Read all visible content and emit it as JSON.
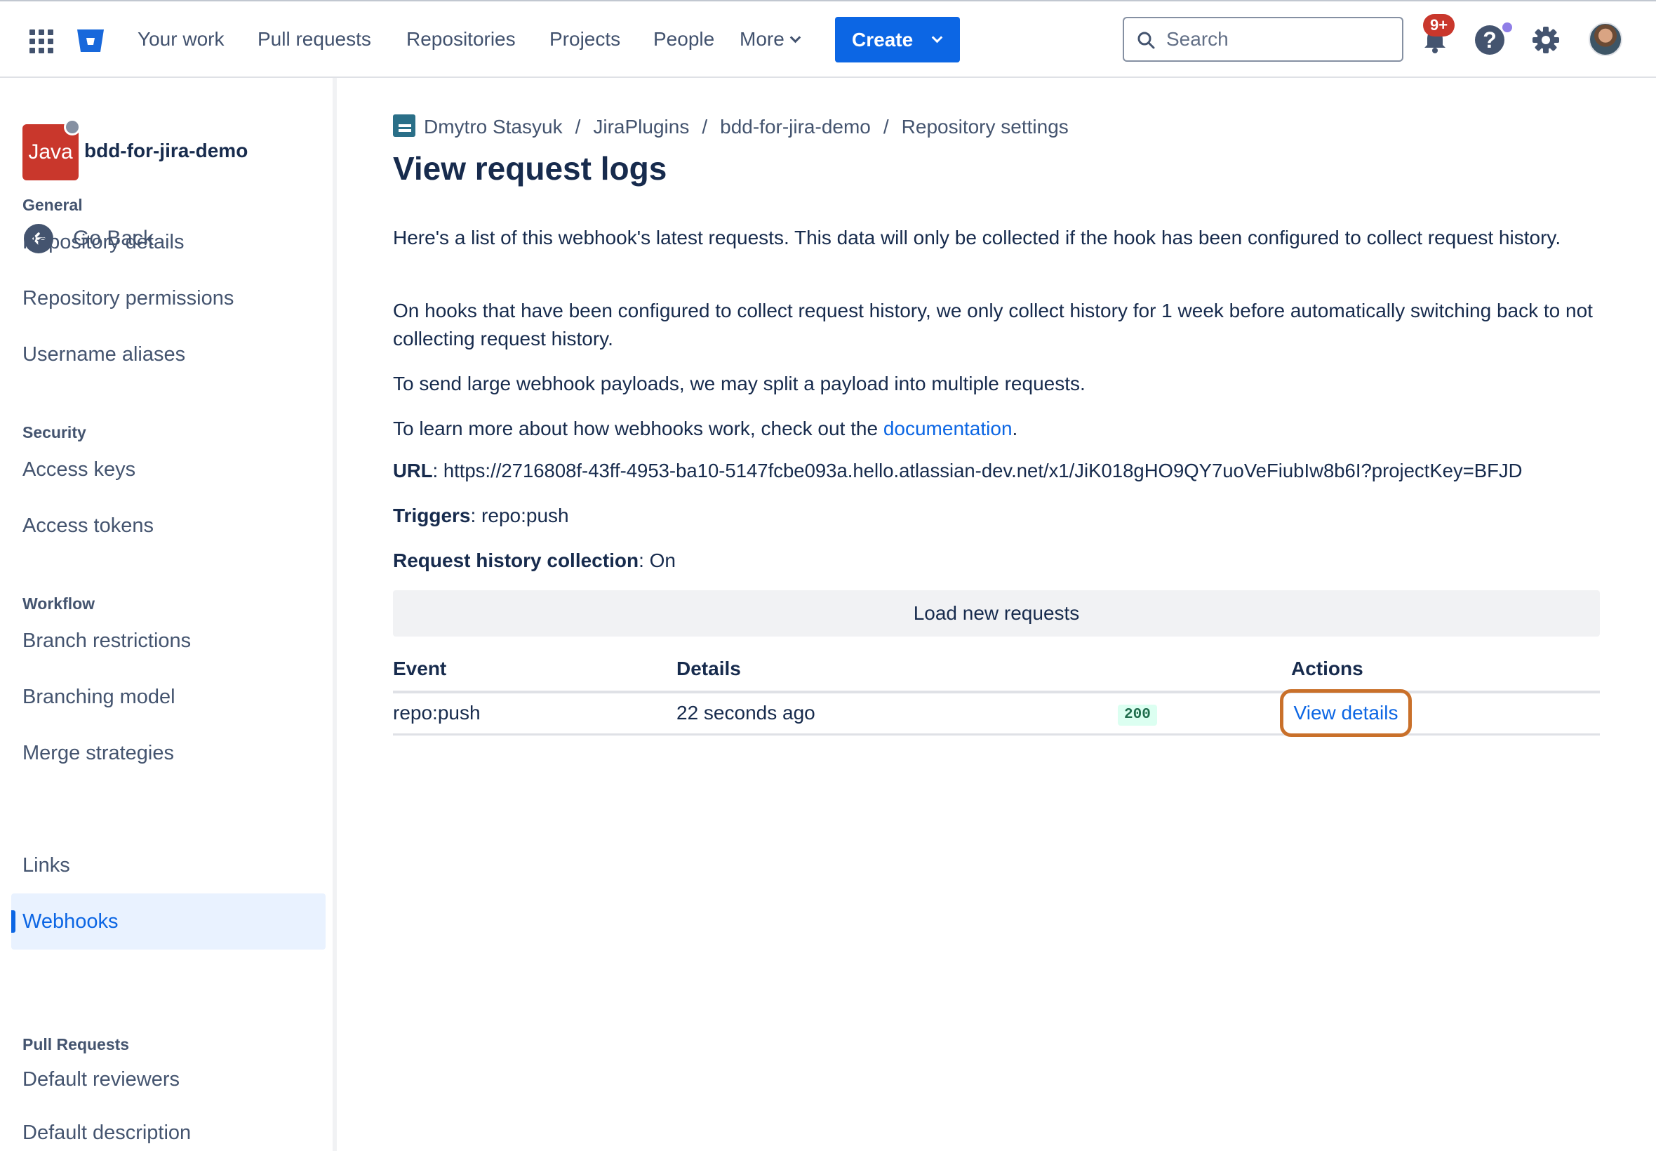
{
  "nav": {
    "items": [
      "Your work",
      "Pull requests",
      "Repositories",
      "Projects",
      "People",
      "More"
    ],
    "create_label": "Create",
    "search_placeholder": "Search",
    "notification_count": "9+"
  },
  "sidebar": {
    "repo_avatar_text": "Java",
    "repo_name": "bdd-for-jira-demo",
    "go_back": "Go Back",
    "sections": [
      {
        "title": "General",
        "items": [
          "Repository details",
          "Repository permissions",
          "Username aliases"
        ]
      },
      {
        "title": "Security",
        "items": [
          "Access keys",
          "Access tokens"
        ]
      },
      {
        "title": "Workflow",
        "items": [
          "Branch restrictions",
          "Branching model",
          "Merge strategies",
          "Webhooks",
          "Links"
        ]
      },
      {
        "title": "Pull Requests",
        "items": [
          "Default reviewers",
          "Default description"
        ]
      }
    ],
    "active_item": "Webhooks"
  },
  "breadcrumb": [
    "Dmytro Stasyuk",
    "JiraPlugins",
    "bdd-for-jira-demo",
    "Repository settings"
  ],
  "page_title": "View request logs",
  "description": {
    "p1": "Here's a list of this webhook's latest requests. This data will only be collected if the hook has been configured to collect request history.",
    "p2": "On hooks that have been configured to collect request history, we only collect history for 1 week before automatically switching back to not collecting request history.",
    "p3": "To send large webhook payloads, we may split a payload into multiple requests.",
    "p4_prefix": "To learn more about how webhooks work, check out the",
    "p4_link": "documentation",
    "p4_suffix": "."
  },
  "details": {
    "url_label": "URL",
    "url_value": "https://2716808f-43ff-4953-ba10-5147fcbe093a.hello.atlassian-dev.net/x1/JiK018gHO9QY7uoVeFiubIw8b6I?projectKey=BFJD",
    "triggers_label": "Triggers",
    "triggers_value": "repo:push",
    "history_label": "Request history collection",
    "history_value": "On"
  },
  "load_button": "Load new requests",
  "table": {
    "headers": {
      "event": "Event",
      "details": "Details",
      "actions": "Actions"
    },
    "rows": [
      {
        "event": "repo:push",
        "time": "22 seconds ago",
        "status": "200",
        "action": "View details"
      }
    ]
  },
  "colors": {
    "primary": "#0c66e4",
    "highlight_outline": "#c9702a",
    "repo_avatar": "#c9372c",
    "success_bg": "#dcfff1"
  }
}
